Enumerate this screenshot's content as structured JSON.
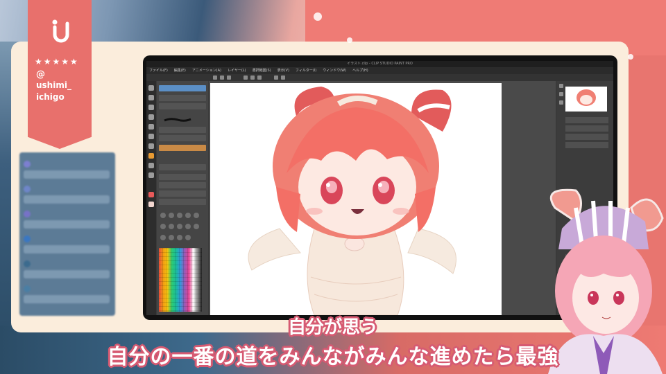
{
  "badge": {
    "stars": "★★★★★",
    "at": "@",
    "handle_line1": "ushimi_",
    "handle_line2": "ichigo"
  },
  "app": {
    "window_title": "イラスト.clip - CLIP STUDIO PAINT PRO",
    "menus": [
      "ファイル(F)",
      "編集(E)",
      "アニメーション(A)",
      "レイヤー(L)",
      "選択範囲(S)",
      "表示(V)",
      "フィルター(I)",
      "ウィンドウ(W)",
      "ヘルプ(H)"
    ]
  },
  "subtitles": {
    "line1": "自分が思う",
    "line2": "自分の一番の道をみんながみんな進めたら最強"
  },
  "colors": {
    "accent": "#e8706c",
    "cream": "#fbeddc",
    "subtitle_outline": "#d65a72"
  }
}
